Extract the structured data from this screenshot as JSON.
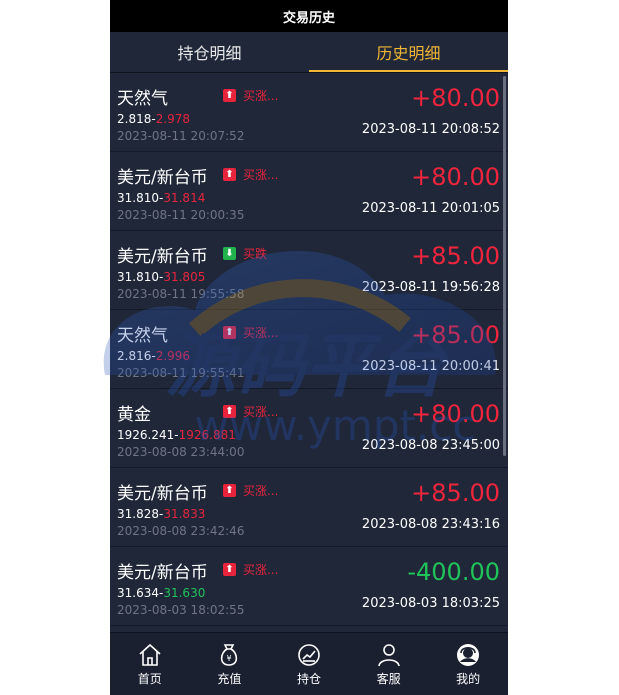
{
  "header": {
    "title": "交易历史"
  },
  "tabs": [
    {
      "label": "持仓明细",
      "active": false
    },
    {
      "label": "历史明细",
      "active": true
    }
  ],
  "trades": [
    {
      "name": "天然气",
      "direction": "买涨...",
      "dir": "up",
      "open": "2.818",
      "close": "2.978",
      "close_color": "red",
      "open_time": "2023-08-11 20:07:52",
      "profit": "+80.00",
      "close_time": "2023-08-11 20:08:52"
    },
    {
      "name": "美元/新台币",
      "direction": "买涨...",
      "dir": "up",
      "open": "31.810",
      "close": "31.814",
      "close_color": "red",
      "open_time": "2023-08-11 20:00:35",
      "profit": "+80.00",
      "close_time": "2023-08-11 20:01:05"
    },
    {
      "name": "美元/新台币",
      "direction": "买跌",
      "dir": "down",
      "open": "31.810",
      "close": "31.805",
      "close_color": "red",
      "open_time": "2023-08-11 19:55:58",
      "profit": "+85.00",
      "close_time": "2023-08-11 19:56:28"
    },
    {
      "name": "天然气",
      "direction": "买涨...",
      "dir": "up",
      "open": "2.816",
      "close": "2.996",
      "close_color": "red",
      "open_time": "2023-08-11 19:55:41",
      "profit": "+85.00",
      "close_time": "2023-08-11 20:00:41"
    },
    {
      "name": "黄金",
      "direction": "买涨...",
      "dir": "up",
      "open": "1926.241",
      "close": "1926.881",
      "close_color": "red",
      "open_time": "2023-08-08 23:44:00",
      "profit": "+80.00",
      "close_time": "2023-08-08 23:45:00"
    },
    {
      "name": "美元/新台币",
      "direction": "买涨...",
      "dir": "up",
      "open": "31.828",
      "close": "31.833",
      "close_color": "red",
      "open_time": "2023-08-08 23:42:46",
      "profit": "+85.00",
      "close_time": "2023-08-08 23:43:16"
    },
    {
      "name": "美元/新台币",
      "direction": "买涨...",
      "dir": "up",
      "open": "31.634",
      "close": "31.630",
      "close_color": "green",
      "open_time": "2023-08-03 18:02:55",
      "profit": "-400.00",
      "close_time": "2023-08-03 18:03:25"
    }
  ],
  "nav": [
    {
      "label": "首页",
      "icon": "home-icon"
    },
    {
      "label": "充值",
      "icon": "money-bag-icon"
    },
    {
      "label": "持仓",
      "icon": "chart-icon"
    },
    {
      "label": "客服",
      "icon": "person-icon"
    },
    {
      "label": "我的",
      "icon": "avatar-icon"
    }
  ],
  "watermark": {
    "text": "源码平台",
    "url": "www.ympt.cc"
  },
  "colors": {
    "up": "#e8243c",
    "down": "#20b34b",
    "accent": "#f2b535",
    "background": "#1f2739"
  }
}
